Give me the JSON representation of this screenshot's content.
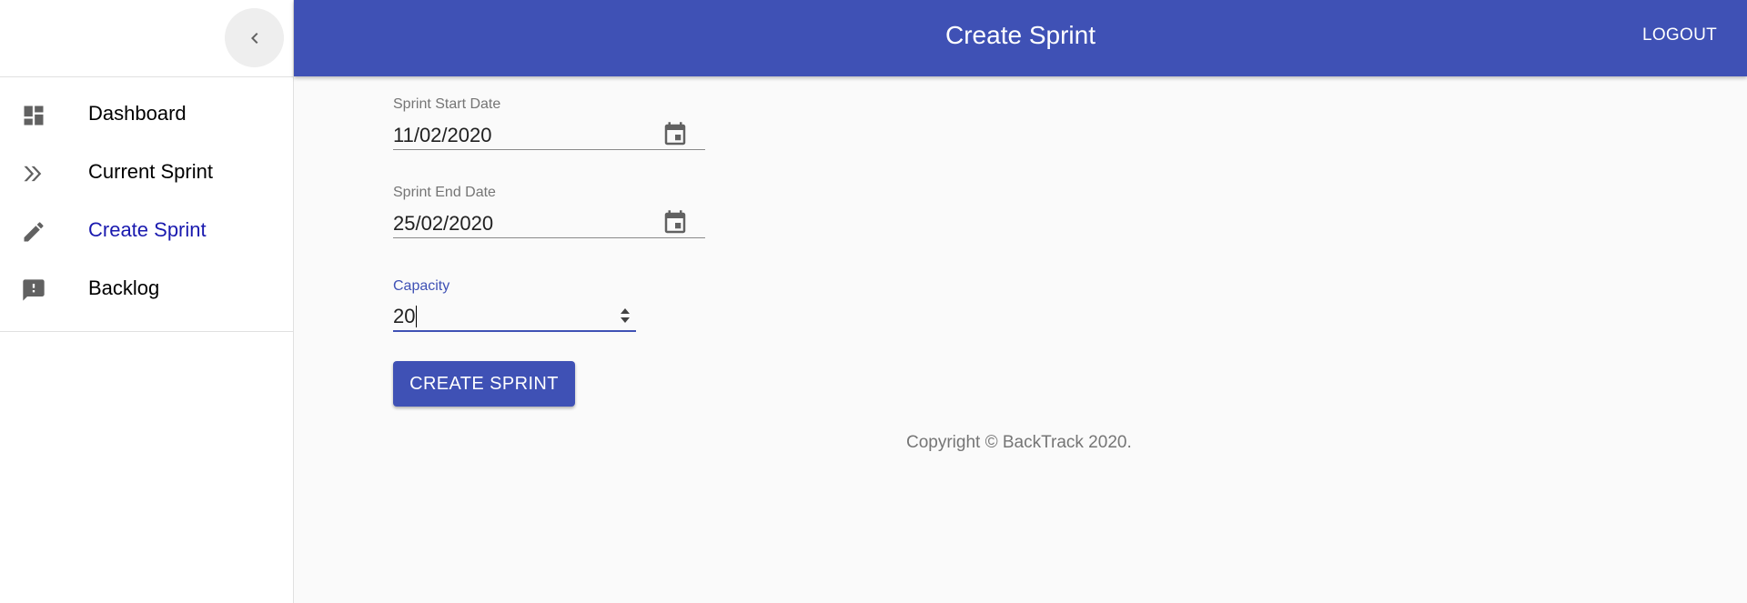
{
  "appbar": {
    "title": "Create Sprint",
    "logout_label": "LOGOUT"
  },
  "sidebar": {
    "collapse_icon": "chevron-left-icon",
    "items": [
      {
        "label": "Dashboard",
        "icon": "dashboard-icon",
        "active": false
      },
      {
        "label": "Current Sprint",
        "icon": "double-chevron-right-icon",
        "active": false
      },
      {
        "label": "Create Sprint",
        "icon": "pencil-icon",
        "active": true
      },
      {
        "label": "Backlog",
        "icon": "feedback-icon",
        "active": false
      }
    ]
  },
  "form": {
    "start_date": {
      "label": "Sprint Start Date",
      "value": "11/02/2020"
    },
    "end_date": {
      "label": "Sprint End Date",
      "value": "25/02/2020"
    },
    "capacity": {
      "label": "Capacity",
      "value": "20"
    },
    "submit_label": "CREATE SPRINT"
  },
  "footer": {
    "copyright": "Copyright © BackTrack 2020."
  },
  "colors": {
    "primary": "#3f51b5",
    "active_nav": "#1a1aaf"
  }
}
